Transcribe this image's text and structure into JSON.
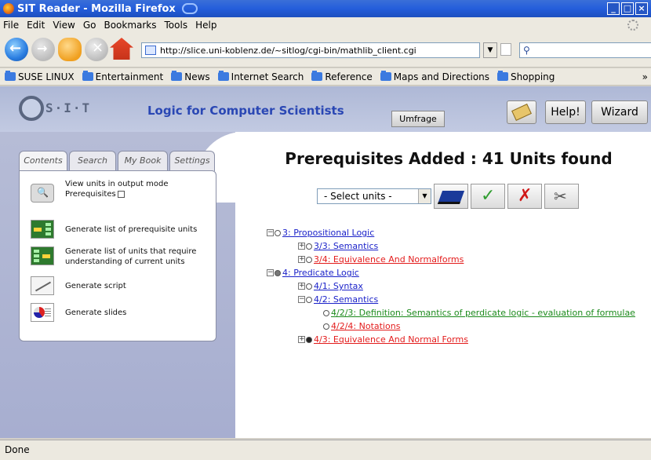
{
  "window": {
    "title": "SIT Reader - Mozilla Firefox"
  },
  "menu": [
    "File",
    "Edit",
    "View",
    "Go",
    "Bookmarks",
    "Tools",
    "Help"
  ],
  "address": {
    "url": "http://slice.uni-koblenz.de/~sitlog/cgi-bin/mathlib_client.cgi"
  },
  "bookmarks": [
    "SUSE LINUX",
    "Entertainment",
    "News",
    "Internet Search",
    "Reference",
    "Maps and Directions",
    "Shopping"
  ],
  "bookmarks_more": "»",
  "header": {
    "logo_text": "S·I·T",
    "site_title": "Logic for Computer Scientists",
    "umfrage": "Umfrage",
    "help": "Help!",
    "wizard": "Wizard"
  },
  "sidebar": {
    "tabs": [
      "Contents",
      "Search",
      "My Book",
      "Settings"
    ],
    "items": [
      {
        "label_line1": "View units in output mode",
        "label_line2": "Prerequisites"
      },
      {
        "label": "Generate list of prerequisite units"
      },
      {
        "label": "Generate list of units that require understanding of current units"
      },
      {
        "label": "Generate script"
      },
      {
        "label": "Generate slides"
      }
    ]
  },
  "main": {
    "title": "Prerequisites Added : 41 Units found",
    "select_value": "- Select units -",
    "tree": [
      {
        "text": "3: Propositional Logic",
        "color": "#1b22c9"
      },
      {
        "text": "3/3: Semantics",
        "color": "#1b22c9"
      },
      {
        "text": "3/4: Equivalence And Normalforms",
        "color": "#e31c1c"
      },
      {
        "text": "4: Predicate Logic",
        "color": "#1b22c9"
      },
      {
        "text": "4/1: Syntax",
        "color": "#1b22c9"
      },
      {
        "text": "4/2: Semantics",
        "color": "#1b22c9"
      },
      {
        "text": "4/2/3: Definition: Semantics of perdicate logic - evaluation of formulae",
        "color": "#1c8a1c"
      },
      {
        "text": "4/2/4: Notations",
        "color": "#e31c1c"
      },
      {
        "text": "4/3: Equivalence And Normal Forms",
        "color": "#e31c1c"
      }
    ]
  },
  "status": {
    "text": "Done"
  }
}
